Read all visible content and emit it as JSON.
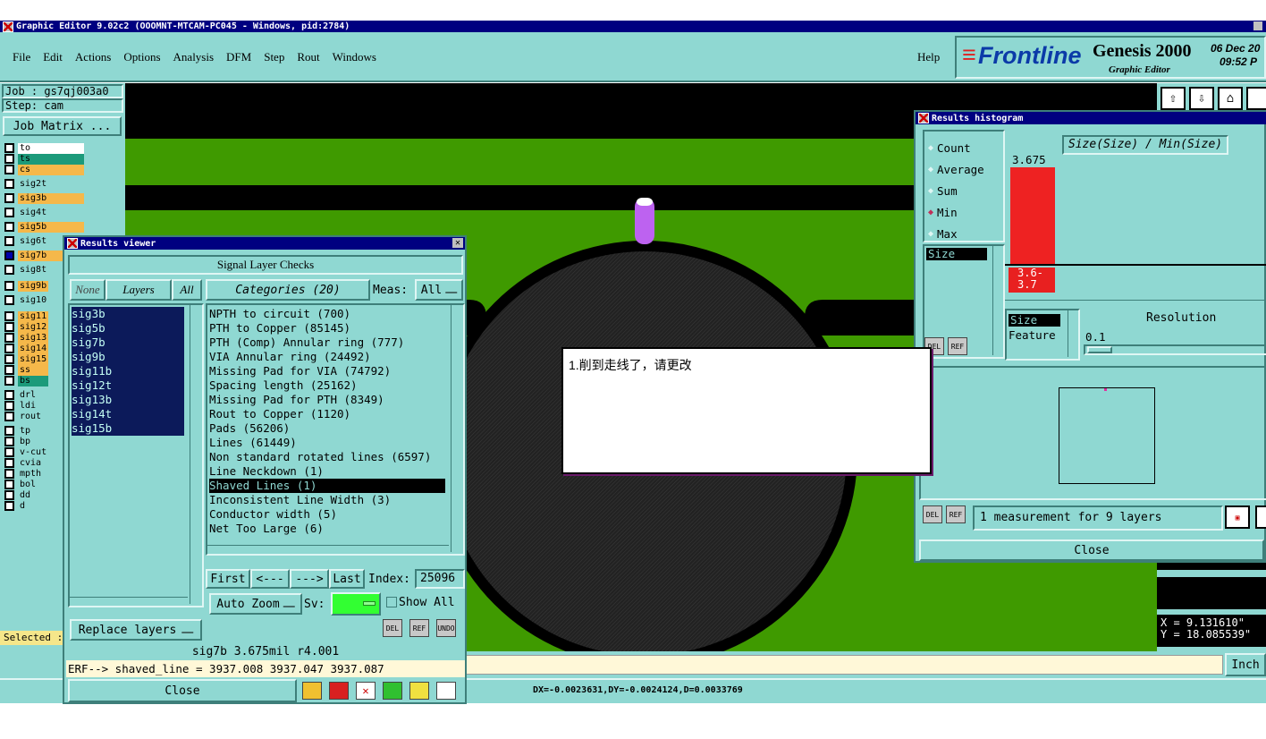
{
  "window": {
    "title": "Graphic Editor 9.02c2 (OOOMNT-MTCAM-PC045 - Windows, pid:2784)"
  },
  "menu": {
    "items": [
      "File",
      "Edit",
      "Actions",
      "Options",
      "Analysis",
      "DFM",
      "Step",
      "Rout",
      "Windows"
    ],
    "help": "Help"
  },
  "brand": {
    "logo": "Frontline",
    "product": "Genesis 2000",
    "subtitle": "Graphic Editor",
    "date": "06 Dec 20",
    "time": "09:52 P"
  },
  "job": {
    "job": "Job : gs7qj003a0",
    "step": "Step: cam",
    "matrix_button": "Job Matrix ..."
  },
  "layers": [
    {
      "name": "to",
      "color": "#ffffff"
    },
    {
      "name": "ts",
      "color": "#1c9a7a"
    },
    {
      "name": "cs",
      "color": "#f5b84a"
    },
    {
      "name": "sig2t",
      "color": "#8fd8d2"
    },
    {
      "name": "sig3b",
      "color": "#f5b84a"
    },
    {
      "name": "sig4t",
      "color": "#8fd8d2"
    },
    {
      "name": "sig5b",
      "color": "#f5b84a"
    },
    {
      "name": "sig6t",
      "color": "#8fd8d2"
    },
    {
      "name": "sig7b",
      "color": "#f5b84a"
    },
    {
      "name": "sig8t",
      "color": "#8fd8d2"
    },
    {
      "name": "sig9b",
      "color": "#f5b84a"
    },
    {
      "name": "sig10",
      "color": "#8fd8d2"
    },
    {
      "name": "sig11",
      "color": "#f5b84a"
    },
    {
      "name": "sig12",
      "color": "#f5b84a"
    },
    {
      "name": "sig13",
      "color": "#f5b84a"
    },
    {
      "name": "sig14",
      "color": "#f5b84a"
    },
    {
      "name": "sig15",
      "color": "#f5b84a"
    },
    {
      "name": "ss",
      "color": "#f5b84a"
    },
    {
      "name": "bs",
      "color": "#1c9a7a"
    },
    {
      "name": "drl",
      "color": "#8fd8d2"
    },
    {
      "name": "ldi",
      "color": "#8fd8d2"
    },
    {
      "name": "rout",
      "color": "#8fd8d2"
    },
    {
      "name": "tp",
      "color": "#8fd8d2"
    },
    {
      "name": "bp",
      "color": "#8fd8d2"
    },
    {
      "name": "v-cut",
      "color": "#8fd8d2"
    },
    {
      "name": "cvia",
      "color": "#8fd8d2"
    },
    {
      "name": "mpth",
      "color": "#8fd8d2"
    },
    {
      "name": "bol",
      "color": "#8fd8d2"
    },
    {
      "name": "dd",
      "color": "#8fd8d2"
    },
    {
      "name": "d",
      "color": "#8fd8d2"
    }
  ],
  "left_status": {
    "selected": "Selected :"
  },
  "results_viewer": {
    "title": "Results viewer",
    "header": "Signal Layer Checks",
    "none_btn": "None",
    "layers_btn": "Layers",
    "all_btn": "All",
    "categories_btn": "Categories (20)",
    "meas_label": "Meas:",
    "meas_value": "All",
    "layer_list": [
      "sig3b",
      "sig5b",
      "sig7b",
      "sig9b",
      "sig11b",
      "sig12t",
      "sig13b",
      "sig14t",
      "sig15b"
    ],
    "categories": [
      "NPTH to circuit (700)",
      "PTH to Copper (85145)",
      "PTH (Comp) Annular ring (777)",
      "VIA Annular ring (24492)",
      "Missing Pad for VIA (74792)",
      "Spacing length (25162)",
      "Missing Pad for PTH (8349)",
      "Rout to Copper (1120)",
      "Pads (56206)",
      "Lines (61449)",
      "Non standard rotated lines (6597)",
      "Line Neckdown (1)",
      "Shaved Lines (1)",
      "Inconsistent Line Width (3)",
      "Conductor width (5)",
      "Net Too Large (6)"
    ],
    "selected_category": "Shaved Lines (1)",
    "first_btn": "First",
    "prev_btn": "<---",
    "next_btn": "--->",
    "last_btn": "Last",
    "index_label": "Index:",
    "index_value": "25096",
    "auto_zoom": "Auto Zoom",
    "sv_label": "Sv:",
    "show_all": "Show All",
    "replace_layers": "Replace layers",
    "del": "DEL",
    "ref": "REF",
    "undo": "UNDO",
    "info_line": "sig7b 3.675mil  r4.001",
    "erf_line": "ERF--> shaved_line = 3937.008 3937.047 3937.087",
    "close": "Close"
  },
  "histogram": {
    "title": "Results histogram",
    "options": [
      {
        "label": "Count",
        "selected": false
      },
      {
        "label": "Average",
        "selected": false
      },
      {
        "label": "Sum",
        "selected": false
      },
      {
        "label": "Min",
        "selected": true
      },
      {
        "label": "Max",
        "selected": false
      }
    ],
    "field_selected": "Size",
    "chart_title": "Size(Size) / Min(Size)",
    "bar_value_label": "3.675",
    "bar_color": "#ee2222",
    "range_label": "3.6-\n3.7",
    "size_item": "Size",
    "feature_item": "Feature",
    "resolution_label": "Resolution",
    "resolution_value": "0.1",
    "del": "DEL",
    "ref": "REF",
    "measurement": "1 measurement for 9 layers",
    "close": "Close"
  },
  "comment": {
    "text": "1.削到走线了，请更改"
  },
  "coords": {
    "x": "X = 9.131610\"",
    "y": "Y = 18.085539\""
  },
  "status": {
    "unit": "Inch",
    "delta": "DX=-0.0023631,DY=-0.0024124,D=0.0033769"
  },
  "colors": {
    "board_green": "#3f9a00",
    "canvas_black": "#000000",
    "panel_teal": "#8fd8d2",
    "title_navy": "#000080",
    "pad_dark": "#161616",
    "pin_violet": "#bd62f0"
  }
}
